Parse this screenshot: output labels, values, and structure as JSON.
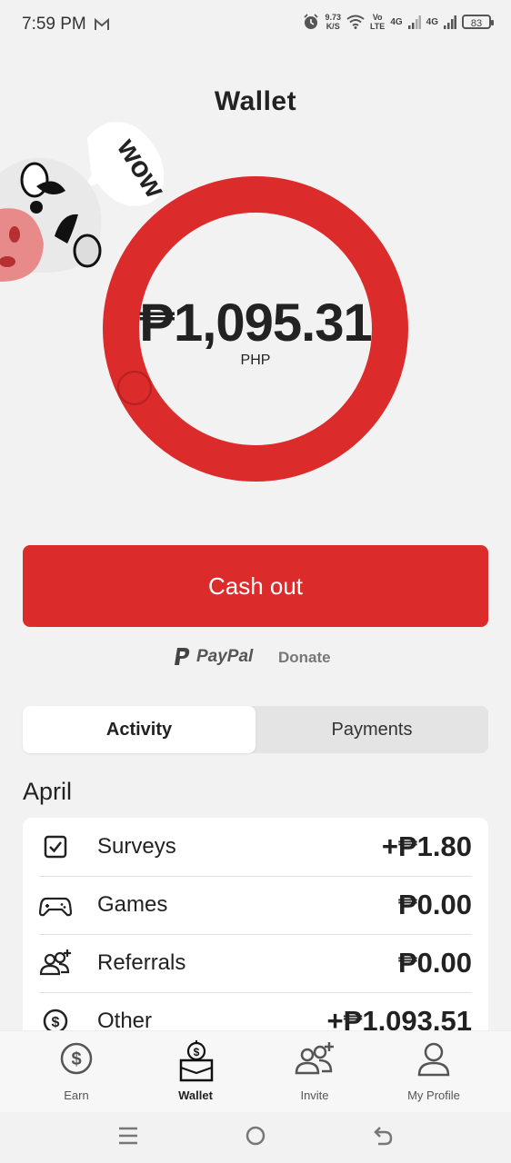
{
  "status": {
    "time": "7:59 PM",
    "speed_value": "9.73",
    "speed_unit": "K/S",
    "volte_top": "Vo",
    "volte_bottom": "LTE",
    "net1": "4G",
    "net2": "4G",
    "battery": "83"
  },
  "header": {
    "title": "Wallet"
  },
  "mascot": {
    "bubble_text": "wow"
  },
  "wallet": {
    "balance": "₱1,095.31",
    "currency": "PHP"
  },
  "actions": {
    "cashout_label": "Cash out",
    "paypal_label": "PayPal",
    "donate_label": "Donate"
  },
  "tabs": [
    {
      "label": "Activity"
    },
    {
      "label": "Payments"
    }
  ],
  "activity": {
    "month": "April",
    "rows": [
      {
        "label": "Surveys",
        "amount": "+₱1.80"
      },
      {
        "label": "Games",
        "amount": "₱0.00"
      },
      {
        "label": "Referrals",
        "amount": "₱0.00"
      },
      {
        "label": "Other",
        "amount": "+₱1,093.51"
      }
    ]
  },
  "nav": [
    {
      "label": "Earn"
    },
    {
      "label": "Wallet"
    },
    {
      "label": "Invite"
    },
    {
      "label": "My Profile"
    }
  ],
  "colors": {
    "accent": "#dc2b2b",
    "ring": "#dc2b2b",
    "background": "#f2f2f2"
  }
}
